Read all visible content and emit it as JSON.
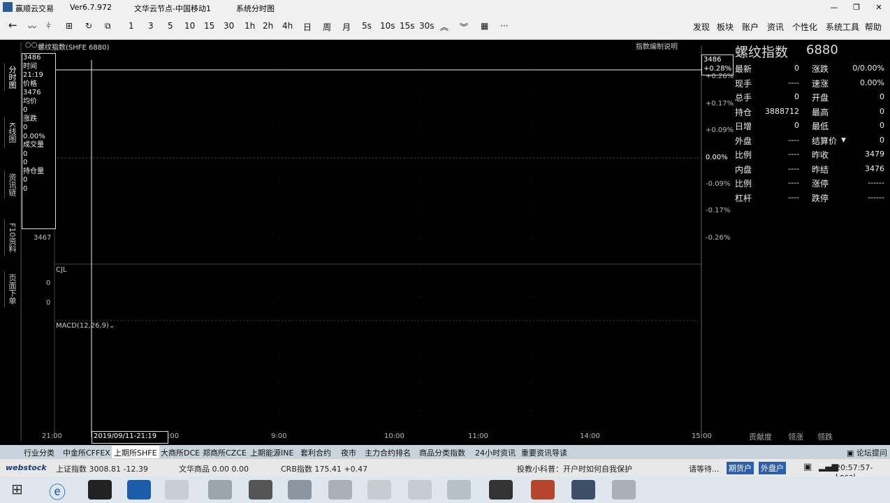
{
  "titlebar": {
    "app_name": "赢顺云交易",
    "version": "Ver6.7.972",
    "server": "文华云节点-中国移动1",
    "view": "系统分时图",
    "minimize": "—",
    "restore": "❐",
    "close": "✕"
  },
  "toolbar": {
    "periods": [
      "1",
      "3",
      "5",
      "10",
      "15",
      "30",
      "1h",
      "2h",
      "4h",
      "日",
      "周",
      "月",
      "5s",
      "10s",
      "15s",
      "30s"
    ],
    "more": "···",
    "menu": [
      "发现",
      "板块",
      "账户",
      "资讯",
      "个性化",
      "系统工具",
      "帮助"
    ]
  },
  "sidetabs": [
    "分时图",
    "K线图",
    "资讯链",
    "F10资料",
    "页面下单"
  ],
  "chart": {
    "header": "螺纹指数(SHFE 6880)",
    "explain_link": "指数编制说明",
    "cursor_price": "3486",
    "cursor_pct": "+0.28%",
    "pct_labels": [
      "+0.26%",
      "+0.17%",
      "+0.09%",
      "0.00%",
      "-0.09%",
      "-0.17%",
      "-0.26%"
    ],
    "left_price_low": "3467",
    "cjl_label": "CJL",
    "cjl_vals": [
      "0",
      "0"
    ],
    "macd_label": "MACD(12,26,9)",
    "x_ticks": [
      "21:00",
      "9:00",
      "10:00",
      "11:00",
      "14:00",
      "15:00"
    ],
    "cursor_time": "2019/09/11-21:19",
    "cursor_time_suffix": ":00",
    "footer_links": [
      "贡献度",
      "领涨",
      "领跌"
    ]
  },
  "hud": {
    "price_top": "3486",
    "time_label": "时间",
    "time": "21:19",
    "price_label": "价格",
    "price": "3476",
    "avg_label": "均价",
    "avg": "0",
    "chg_label": "涨跌",
    "chg": "0",
    "chg_pct": "0.00%",
    "vol_label": "成交量",
    "vol1": "0",
    "vol2": "0",
    "oi_label": "持仓量",
    "oi1": "0",
    "oi2": "0"
  },
  "quote": {
    "name": "螺纹指数",
    "code": "6880",
    "left": [
      {
        "label": "最新",
        "value": "0"
      },
      {
        "label": "现手",
        "value": "----"
      },
      {
        "label": "总手",
        "value": "0"
      },
      {
        "label": "持仓",
        "value": "3888712"
      },
      {
        "label": "日增",
        "value": "0"
      },
      {
        "label": "外盘",
        "value": "----"
      },
      {
        "label": "比例",
        "value": "----"
      },
      {
        "label": "内盘",
        "value": "----"
      },
      {
        "label": "比例",
        "value": "----"
      },
      {
        "label": "杠杆",
        "value": "----"
      }
    ],
    "right": [
      {
        "label": "涨跌",
        "value": "0/0.00%"
      },
      {
        "label": "速涨",
        "value": "0.00%"
      },
      {
        "label": "开盘",
        "value": "0"
      },
      {
        "label": "最高",
        "value": "0"
      },
      {
        "label": "最低",
        "value": "0"
      },
      {
        "label": "结算价",
        "value": "0"
      },
      {
        "label": "昨收",
        "value": "3479"
      },
      {
        "label": "昨结",
        "value": "3476"
      },
      {
        "label": "涨停",
        "value": "------"
      },
      {
        "label": "跌停",
        "value": "------"
      }
    ]
  },
  "bottom_tabs": [
    "行业分类",
    "中金所CFFEX",
    "上期所SHFE",
    "大商所DCE",
    "郑商所CZCE",
    "上期能源INE",
    "套利合约",
    "夜市",
    "主力合约排名",
    "商品分类指数",
    "24小时资讯",
    "重要资讯导读"
  ],
  "forum": "论坛提问",
  "ticker": {
    "brand": "webstock",
    "sh_index": "上证指数  3008.81  -12.39",
    "wh_index": "文华商品  0.00  0.00",
    "crb_index": "CRB指数   175.41  +0.47",
    "tip": "投教小科普：开户时如何自我保护",
    "waiting": "请等待...",
    "btn_open_futures": "期货户",
    "btn_open_foreign": "外盘户",
    "clock": "20:57:57-Local"
  },
  "colors": {
    "bg": "#000000",
    "grid": "#7a1a1a",
    "cursor": "#ffffff",
    "bar": "#f0f0f0"
  }
}
